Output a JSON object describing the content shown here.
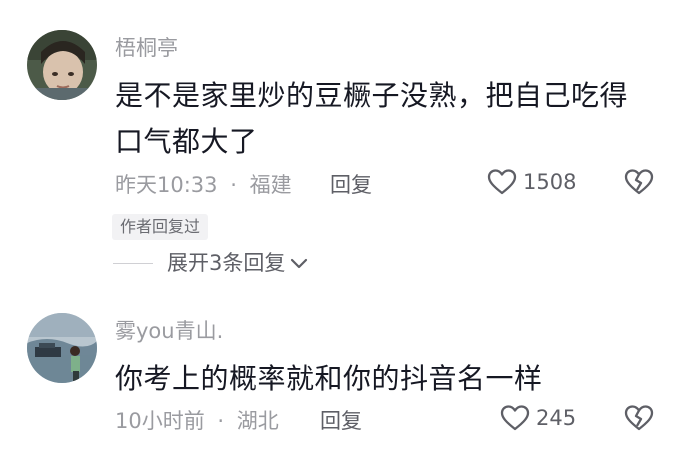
{
  "comments": [
    {
      "username": "梧桐亭",
      "text_lines": [
        "是不是家里炒的豆橛子没熟，把自己吃得",
        "口气都大了"
      ],
      "time": "昨天10:33",
      "separator": "·",
      "location": "福建",
      "reply_label": "回复",
      "like_count": "1508",
      "author_badge": "作者回复过",
      "expand_label": "展开3条回复"
    },
    {
      "username": "雾you青山.",
      "text_lines": [
        "你考上的概率就和你的抖音名一样"
      ],
      "time": "10小时前",
      "separator": "·",
      "location": "湖北",
      "reply_label": "回复",
      "like_count": "245"
    }
  ],
  "icons": {
    "like": "heart-outline-icon",
    "dislike": "broken-heart-icon",
    "expand": "chevron-down-icon"
  },
  "colors": {
    "text_primary": "#161823",
    "text_secondary": "#9a9ba0",
    "action_text": "#5e5f66",
    "badge_bg": "#f2f2f4"
  }
}
